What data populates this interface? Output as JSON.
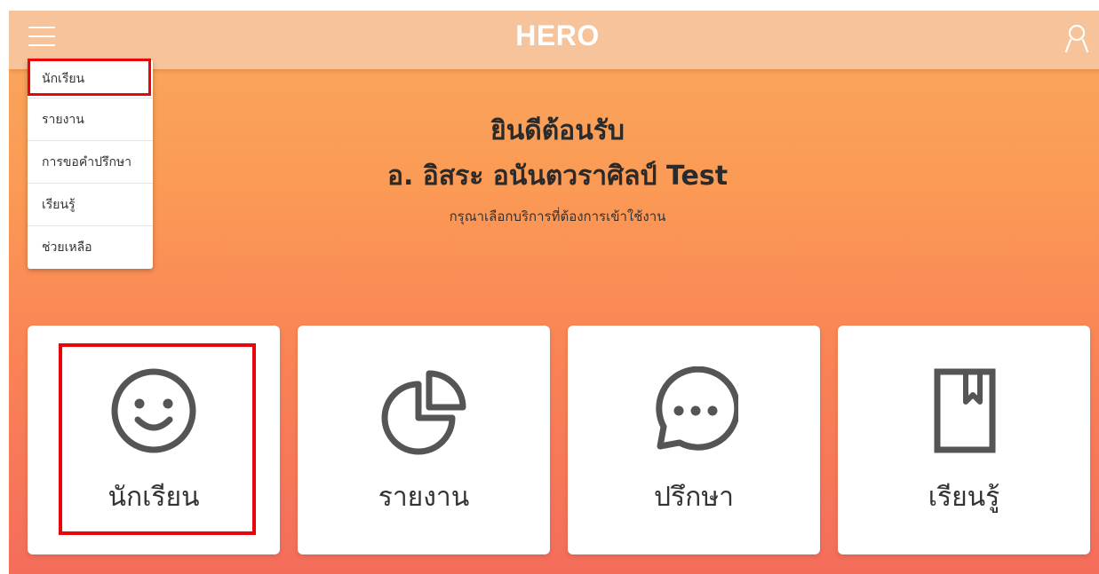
{
  "header": {
    "brand": "HERO",
    "menu_icon": "hamburger-menu-icon",
    "user_icon": "user-icon"
  },
  "menu": {
    "items": [
      {
        "label": "นักเรียน",
        "highlighted": true
      },
      {
        "label": "รายงาน"
      },
      {
        "label": "การขอคำปรึกษา"
      },
      {
        "label": "เรียนรู้"
      },
      {
        "label": "ช่วยเหลือ"
      }
    ]
  },
  "welcome": {
    "title": "ยินดีต้อนรับ",
    "name": "อ. อิสระ อนันตวราศิลป์ Test",
    "subtitle": "กรุณาเลือกบริการที่ต้องการเข้าใช้งาน"
  },
  "cards": [
    {
      "label": "นักเรียน",
      "icon": "smiley-face-icon",
      "highlighted": true
    },
    {
      "label": "รายงาน",
      "icon": "pie-chart-icon"
    },
    {
      "label": "ปรึกษา",
      "icon": "chat-bubble-icon"
    },
    {
      "label": "เรียนรู้",
      "icon": "bookmark-book-icon"
    }
  ],
  "colors": {
    "header": "#f6c39a",
    "gradient_top": "#f9a85d",
    "gradient_bottom": "#f46d5a",
    "highlight": "#e8050b",
    "icon": "#555555"
  }
}
